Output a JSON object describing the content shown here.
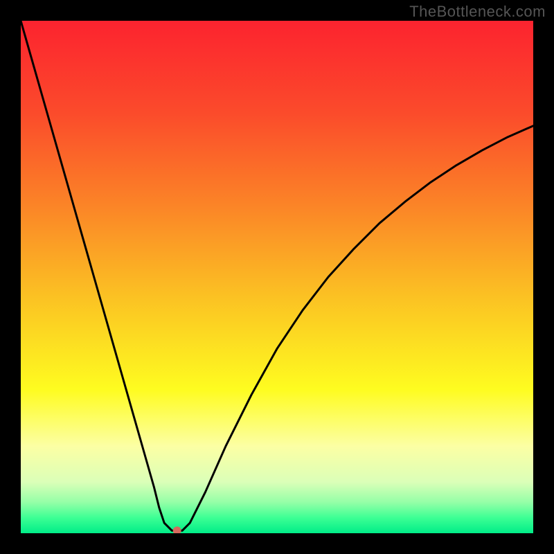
{
  "watermark": "TheBottleneck.com",
  "chart_data": {
    "type": "line",
    "title": "",
    "xlabel": "",
    "ylabel": "",
    "xlim": [
      0,
      100
    ],
    "ylim": [
      0,
      100
    ],
    "grid": false,
    "legend": false,
    "background_gradient": {
      "stops": [
        {
          "offset": 0.0,
          "color": "#fc232f"
        },
        {
          "offset": 0.18,
          "color": "#fb4b2b"
        },
        {
          "offset": 0.36,
          "color": "#fb8427"
        },
        {
          "offset": 0.54,
          "color": "#fbc223"
        },
        {
          "offset": 0.72,
          "color": "#fefc20"
        },
        {
          "offset": 0.83,
          "color": "#fcffa4"
        },
        {
          "offset": 0.9,
          "color": "#dbffb8"
        },
        {
          "offset": 0.94,
          "color": "#94ffa7"
        },
        {
          "offset": 0.97,
          "color": "#3cff94"
        },
        {
          "offset": 1.0,
          "color": "#00ed88"
        }
      ]
    },
    "series": [
      {
        "name": "bottleneck-curve",
        "color": "#000000",
        "x": [
          0,
          2,
          4,
          6,
          8,
          10,
          12,
          14,
          16,
          18,
          20,
          22,
          24,
          26,
          27,
          28,
          29,
          29.5,
          30.5,
          31.5,
          33,
          36,
          40,
          45,
          50,
          55,
          60,
          65,
          70,
          75,
          80,
          85,
          90,
          95,
          100
        ],
        "y": [
          100,
          93,
          86,
          79,
          72,
          65,
          58,
          51,
          44,
          37,
          30,
          23,
          16,
          9,
          5,
          2,
          1,
          0.5,
          0.5,
          0.5,
          2,
          8,
          17,
          27,
          36,
          43.5,
          50,
          55.5,
          60.5,
          64.7,
          68.5,
          71.8,
          74.7,
          77.3,
          79.5
        ]
      }
    ],
    "marker": {
      "name": "optimal-point",
      "x": 30.5,
      "y": 0.5,
      "radius": 6,
      "color": "#d66a5e"
    }
  }
}
